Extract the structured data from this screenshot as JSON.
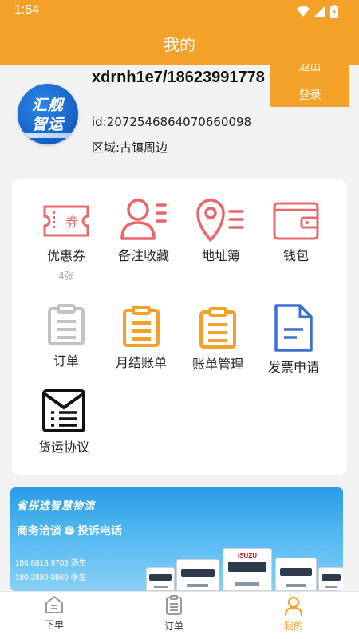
{
  "status_bar": {
    "time": "1:54"
  },
  "header": {
    "title": "我的"
  },
  "profile": {
    "avatar_line1": "汇舰",
    "avatar_line2": "智运",
    "username": "xdrnh1e7/18623991778",
    "uid": "id:2072546864070660098",
    "region": "区域:古镇周边",
    "logout_label": "退出登录"
  },
  "menu": {
    "coupon": {
      "label": "优惠券",
      "count": "4张"
    },
    "favorites": {
      "label": "备注收藏"
    },
    "address_book": {
      "label": "地址簿"
    },
    "wallet": {
      "label": "钱包"
    },
    "orders": {
      "label": "订单"
    },
    "monthly_bill": {
      "label": "月结账单"
    },
    "bill_manage": {
      "label": "账单管理"
    },
    "invoice": {
      "label": "发票申请"
    },
    "agreement": {
      "label": "货运协议"
    }
  },
  "banner": {
    "slogan": "省拼选智慧物流",
    "business": "商务洽谈",
    "complaint": "投诉电话",
    "contact1": "186 8813 9703 汤生",
    "contact2": "180 3889 0869 李生",
    "truck_brand": "ISUZU"
  },
  "tabbar": {
    "tab1": "下单",
    "tab2": "订单",
    "tab3": "我的"
  },
  "colors": {
    "accent": "#f3a128",
    "coral": "#e8676b",
    "blue": "#3d6fd3",
    "grey": "#c2c2c2"
  }
}
